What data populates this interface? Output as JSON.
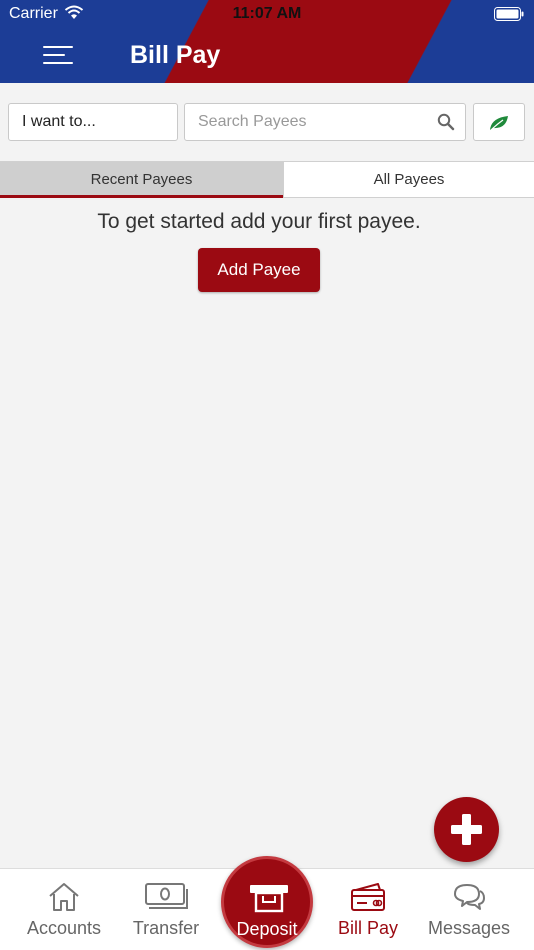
{
  "status_bar": {
    "carrier": "Carrier",
    "time": "11:07 AM"
  },
  "header": {
    "title": "Bill Pay"
  },
  "toolbar": {
    "action_select_value": "I want to...",
    "search_placeholder": "Search Payees"
  },
  "tabs": [
    {
      "label": "Recent Payees",
      "active": true
    },
    {
      "label": "All Payees",
      "active": false
    }
  ],
  "main": {
    "empty_message": "To get started add your first payee.",
    "add_payee_label": "Add Payee"
  },
  "bottom_nav": {
    "items": [
      {
        "label": "Accounts",
        "icon": "home-icon"
      },
      {
        "label": "Transfer",
        "icon": "cash-icon"
      },
      {
        "label": "Deposit",
        "icon": "deposit-icon"
      },
      {
        "label": "Bill Pay",
        "icon": "bill-pay-icon",
        "active": true
      },
      {
        "label": "Messages",
        "icon": "messages-icon"
      }
    ]
  },
  "colors": {
    "brand_red": "#9b0a12",
    "brand_blue": "#1c3d96",
    "leaf_green": "#1f8a3b"
  }
}
